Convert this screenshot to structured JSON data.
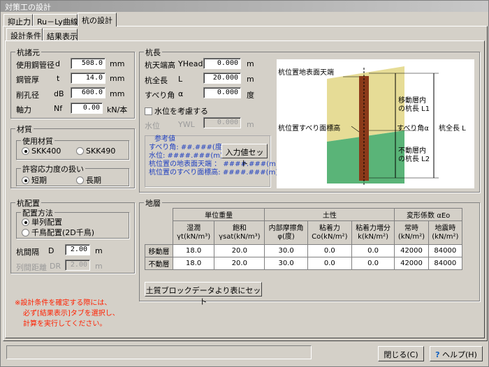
{
  "window": {
    "title": "対策工の設計"
  },
  "main_tabs": [
    "抑止力",
    "Ru－Ly曲線",
    "杭の設計"
  ],
  "sub_tabs": [
    "設計条件",
    "結果表示"
  ],
  "pile_spec": {
    "title": "杭諸元",
    "rows": [
      {
        "label": "使用鋼管径",
        "sym": "d",
        "value": "508.0",
        "unit": "mm"
      },
      {
        "label": "鋼管厚",
        "sym": "t",
        "value": "14.0",
        "unit": "mm"
      },
      {
        "label": "削孔径",
        "sym": "dB",
        "value": "600.0",
        "unit": "mm"
      },
      {
        "label": "軸力",
        "sym": "Nf",
        "value": "0.00",
        "unit": "kN/本"
      }
    ]
  },
  "material": {
    "title": "材質",
    "sub1": "使用材質",
    "opt1": "SKK400",
    "opt2": "SKK490",
    "sub2": "許容応力度の扱い",
    "opt3": "短期",
    "opt4": "長期"
  },
  "layout": {
    "title": "杭配置",
    "sub": "配置方法",
    "opt1": "単列配置",
    "opt2": "千鳥配置(2D千鳥)",
    "spacing_label": "杭間隔",
    "spacing_sym": "D",
    "spacing_value": "2.00",
    "spacing_unit": "m",
    "row_label": "列間距離",
    "row_sym": "DR",
    "row_value": "2.00",
    "row_unit": "m"
  },
  "note": [
    "※設計条件を確定する際には、",
    "必ず[結果表示]タブを選択し、",
    "計算を実行してください。"
  ],
  "pile_length": {
    "title": "杭長",
    "rows": [
      {
        "label": "杭天端高",
        "sym": "YHead",
        "value": "0.000",
        "unit": "m"
      },
      {
        "label": "杭全長",
        "sym": "L",
        "value": "20.000",
        "unit": "m"
      },
      {
        "label": "すべり角",
        "sym": "α",
        "value": "0.000",
        "unit": "度"
      }
    ],
    "water_check": "水位を考慮する",
    "water_label": "水位",
    "water_sym": "YWL",
    "water_value": "0.000",
    "water_unit": "m",
    "ref_title": "参考値",
    "ref": [
      "すべり角: ##.###(度)",
      "水位: ####.###(m)",
      "杭位置の地表面天端 ： ####.###(m)",
      "杭位置のすべり面標高: ####.###(m)"
    ],
    "set_button": "入力値セット"
  },
  "diagram": {
    "top_label": "杭位置地表面天端",
    "slip_label": "杭位置すべり面標高",
    "slip_angle": "すべり角α",
    "moving": [
      "移動層内",
      "の杭長 L1"
    ],
    "fixed": [
      "不動層内",
      "の杭長 L2"
    ],
    "total": "杭全長 L"
  },
  "strata": {
    "title": "地層",
    "group_headers": [
      "単位重量",
      "土性",
      "変形係数 αEo"
    ],
    "col_headers": [
      "湿潤\nγt(kN/m³)",
      "飽和\nγsat(kN/m³)",
      "内部摩擦角\nφ(度)",
      "粘着力\nCo(kN/m²)",
      "粘着力増分\nk(kN/m²)",
      "常時\n(kN/m²)",
      "地震時\n(kN/m²)"
    ],
    "rows": [
      {
        "name": "移動層",
        "values": [
          "18.0",
          "20.0",
          "30.0",
          "0.0",
          "0.0",
          "42000",
          "84000"
        ]
      },
      {
        "name": "不動層",
        "values": [
          "18.0",
          "20.0",
          "30.0",
          "0.0",
          "0.0",
          "42000",
          "84000"
        ]
      }
    ],
    "set_button": "土質ブロックデータより表にセット"
  },
  "footer": {
    "close": "閉じる(C)",
    "help": "ヘルプ(H)"
  },
  "colors": {
    "moving_layer": "#e6dc96",
    "fixed_layer": "#5ab478",
    "pile": "#8b3a1a"
  }
}
